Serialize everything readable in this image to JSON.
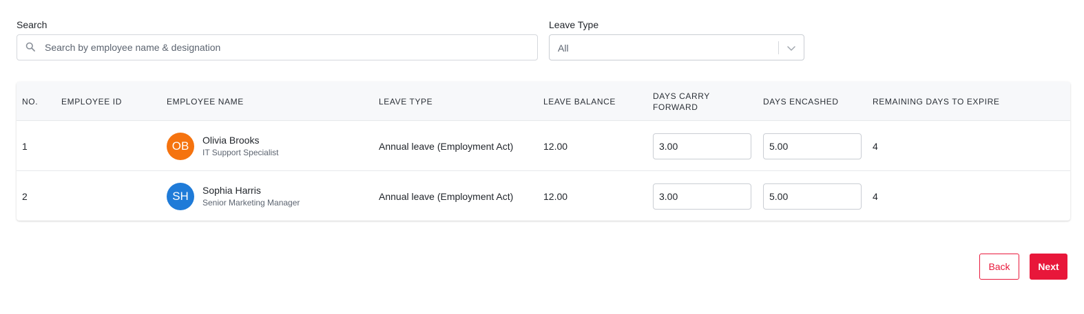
{
  "filters": {
    "search_label": "Search",
    "search_placeholder": "Search by employee name & designation",
    "leave_type_label": "Leave Type",
    "leave_type_value": "All"
  },
  "table": {
    "headers": {
      "no": "NO.",
      "employee_id": "EMPLOYEE ID",
      "employee_name": "EMPLOYEE NAME",
      "leave_type": "LEAVE TYPE",
      "leave_balance": "LEAVE BALANCE",
      "days_carry_forward": "DAYS CARRY FORWARD",
      "days_encashed": "DAYS ENCASHED",
      "remaining_days": "REMAINING DAYS TO EXPIRE"
    },
    "rows": [
      {
        "no": "1",
        "employee_id": "",
        "initials": "OB",
        "avatar_color": "#f5730f",
        "name": "Olivia Brooks",
        "designation": "IT Support Specialist",
        "leave_type": "Annual leave (Employment Act)",
        "leave_balance": "12.00",
        "days_carry_forward": "3.00",
        "days_encashed": "5.00",
        "remaining_days": "4"
      },
      {
        "no": "2",
        "employee_id": "",
        "initials": "SH",
        "avatar_color": "#1f7bd8",
        "name": "Sophia Harris",
        "designation": "Senior Marketing Manager",
        "leave_type": "Annual leave (Employment Act)",
        "leave_balance": "12.00",
        "days_carry_forward": "3.00",
        "days_encashed": "5.00",
        "remaining_days": "4"
      }
    ]
  },
  "actions": {
    "back_label": "Back",
    "next_label": "Next"
  },
  "colors": {
    "accent": "#e8173a"
  },
  "icons": {
    "search": "search-icon",
    "dropdown": "chevron-down-icon"
  }
}
